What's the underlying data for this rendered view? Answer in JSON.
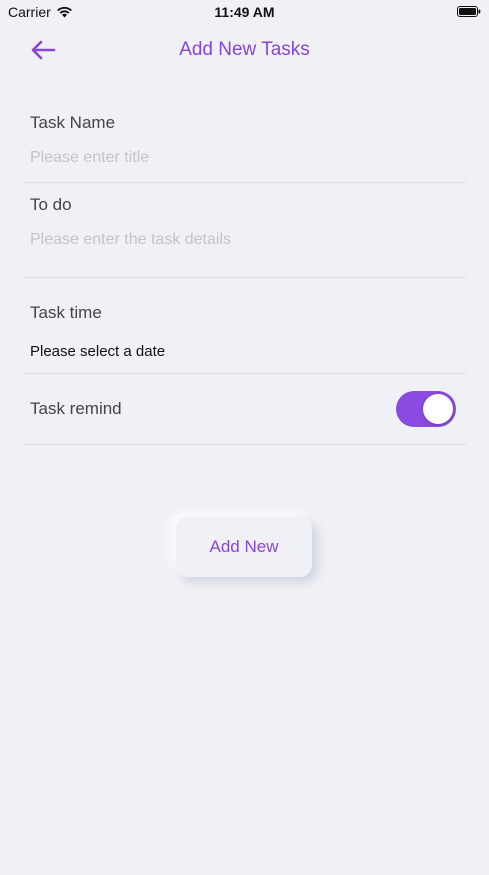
{
  "status_bar": {
    "carrier": "Carrier",
    "time": "11:49 AM"
  },
  "nav": {
    "title": "Add New Tasks",
    "back_icon": "arrow-left-icon"
  },
  "form": {
    "task_name": {
      "label": "Task Name",
      "value": "",
      "placeholder": "Please enter title"
    },
    "todo": {
      "label": "To do",
      "value": "",
      "placeholder": "Please enter the task details"
    },
    "task_time": {
      "label": "Task time",
      "value": "Please select a date"
    },
    "task_remind": {
      "label": "Task remind",
      "enabled": true
    }
  },
  "add_button": {
    "label": "Add New"
  },
  "colors": {
    "background": "#eff1f6",
    "accent": "#8a44d6",
    "toggle_on": "#8b4ae0",
    "placeholder": "#c2c4ca",
    "divider": "#dcdee4"
  }
}
